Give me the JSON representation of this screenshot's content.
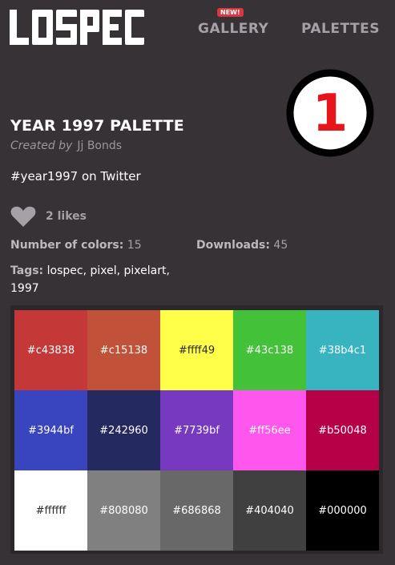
{
  "header": {
    "logo_text": "LOSPEC",
    "nav": [
      {
        "label": "GALLERY",
        "badge": "NEW!"
      },
      {
        "label": "PALETTES"
      }
    ]
  },
  "rank": "1",
  "palette": {
    "title": "YEAR 1997 PALETTE",
    "created_by_label": "Created by",
    "author": "Jj Bonds",
    "description": "#year1997 on Twitter",
    "likes": "2 likes",
    "colors_label": "Number of colors:",
    "colors_count": "15",
    "downloads_label": "Downloads:",
    "downloads_count": "45",
    "tags_label": "Tags:",
    "tags": [
      "lospec",
      "pixel",
      "pixelart",
      "1997"
    ]
  },
  "swatches": [
    {
      "hex": "#c43838",
      "text_color": "#ffffff"
    },
    {
      "hex": "#c15138",
      "text_color": "#ffffff"
    },
    {
      "hex": "#ffff49",
      "text_color": "#2b282b"
    },
    {
      "hex": "#43c138",
      "text_color": "#ffffff"
    },
    {
      "hex": "#38b4c1",
      "text_color": "#ffffff"
    },
    {
      "hex": "#3944bf",
      "text_color": "#ffffff"
    },
    {
      "hex": "#242960",
      "text_color": "#ffffff"
    },
    {
      "hex": "#7739bf",
      "text_color": "#ffffff"
    },
    {
      "hex": "#ff56ee",
      "text_color": "#ffffff"
    },
    {
      "hex": "#b50048",
      "text_color": "#ffffff"
    },
    {
      "hex": "#ffffff",
      "text_color": "#2b282b"
    },
    {
      "hex": "#808080",
      "text_color": "#ffffff"
    },
    {
      "hex": "#686868",
      "text_color": "#ffffff"
    },
    {
      "hex": "#404040",
      "text_color": "#ffffff"
    },
    {
      "hex": "#000000",
      "text_color": "#ffffff"
    }
  ],
  "icons": {
    "heart": "heart-icon"
  },
  "colors": {
    "background": "#363236",
    "badge": "#d6383f",
    "rank_ring": "#000000",
    "rank_number": "#e8141c"
  }
}
